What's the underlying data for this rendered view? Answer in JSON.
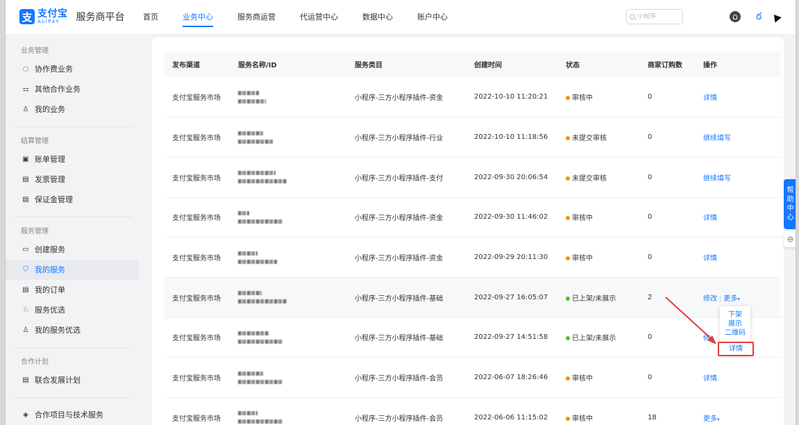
{
  "header": {
    "logo_mark": "支",
    "logo_cn": "支付宝",
    "logo_en": "ALIPAY",
    "platform": "服务商平台",
    "nav": [
      {
        "label": "首页",
        "active": false
      },
      {
        "label": "业务中心",
        "active": true
      },
      {
        "label": "服务商运营",
        "active": false
      },
      {
        "label": "代运营中心",
        "active": false
      },
      {
        "label": "数据中心",
        "active": false
      },
      {
        "label": "账户中心",
        "active": false
      }
    ],
    "search_placeholder": "小程序"
  },
  "sidebar": {
    "groups": [
      {
        "title": "业务管理",
        "items": [
          {
            "icon": "◌",
            "label": "协作费业务"
          },
          {
            "icon": "⚏",
            "label": "其他合作业务"
          },
          {
            "icon": "♙",
            "label": "我的业务"
          }
        ]
      },
      {
        "title": "结算管理",
        "items": [
          {
            "icon": "▣",
            "label": "账单管理"
          },
          {
            "icon": "▤",
            "label": "发票管理"
          },
          {
            "icon": "▤",
            "label": "保证金管理"
          }
        ]
      },
      {
        "title": "服务管理",
        "items": [
          {
            "icon": "▭",
            "label": "创建服务"
          },
          {
            "icon": "⛉",
            "label": "我的服务",
            "active": true
          },
          {
            "icon": "▤",
            "label": "我的订单"
          },
          {
            "icon": "♘",
            "label": "服务优选"
          },
          {
            "icon": "♙",
            "label": "我的服务优选"
          }
        ]
      },
      {
        "title": "合作计划",
        "items": [
          {
            "icon": "▤",
            "label": "联合发展计划"
          }
        ]
      }
    ],
    "bottom_item": {
      "icon": "◈",
      "label": "合作项目与技术服务"
    }
  },
  "table": {
    "columns": [
      "发布渠道",
      "服务名称/ID",
      "服务类目",
      "创建时间",
      "状态",
      "商家订购数",
      "操作"
    ],
    "rows": [
      {
        "channel": "支付宝服务市场",
        "category": "小程序-三方小程序插件-资金",
        "created": "2022-10-10 11:20:21",
        "status": "审核中",
        "status_color": "#fa8c16",
        "orders": "0",
        "actions": [
          "详情"
        ]
      },
      {
        "channel": "支付宝服务市场",
        "category": "小程序-三方小程序插件-行业",
        "created": "2022-10-10 11:18:56",
        "status": "未提交审核",
        "status_color": "#fa8c16",
        "orders": "0",
        "actions": [
          "继续填写"
        ]
      },
      {
        "channel": "支付宝服务市场",
        "category": "小程序-三方小程序插件-支付",
        "created": "2022-09-30 20:06:54",
        "status": "未提交审核",
        "status_color": "#fa8c16",
        "orders": "0",
        "actions": [
          "继续填写"
        ]
      },
      {
        "channel": "支付宝服务市场",
        "category": "小程序-三方小程序插件-资金",
        "created": "2022-09-30 11:46:02",
        "status": "审核中",
        "status_color": "#fa8c16",
        "orders": "0",
        "actions": [
          "详情"
        ]
      },
      {
        "channel": "支付宝服务市场",
        "category": "小程序-三方小程序插件-资金",
        "created": "2022-09-29 20:11:30",
        "status": "审核中",
        "status_color": "#fa8c16",
        "orders": "0",
        "actions": [
          "详情"
        ]
      },
      {
        "channel": "支付宝服务市场",
        "category": "小程序-三方小程序插件-基础",
        "created": "2022-09-27 16:05:07",
        "status": "已上架/未展示",
        "status_color": "#52c41a",
        "orders": "2",
        "actions": [
          "修改",
          "更多"
        ],
        "highlight": true
      },
      {
        "channel": "支付宝服务市场",
        "category": "小程序-三方小程序插件-基础",
        "created": "2022-09-27 14:51:58",
        "status": "已上架/未展示",
        "status_color": "#52c41a",
        "orders": "0",
        "actions": [
          "修"
        ]
      },
      {
        "channel": "支付宝服务市场",
        "category": "小程序-三方小程序插件-会员",
        "created": "2022-06-07 18:26:46",
        "status": "审核中",
        "status_color": "#fa8c16",
        "orders": "0",
        "actions": [
          "详情"
        ]
      },
      {
        "channel": "支付宝服务市场",
        "category": "小程序-三方小程序插件-会员",
        "created": "2022-06-06 11:15:02",
        "status": "审核中",
        "status_color": "#fa8c16",
        "orders": "18",
        "actions": [
          "更多"
        ]
      }
    ]
  },
  "dropdown": {
    "items": [
      "下架",
      "展示",
      "二维码"
    ],
    "highlighted": "详情"
  },
  "help": {
    "chars": [
      "帮",
      "助",
      "中",
      "心"
    ],
    "secondary_icon": "⊖"
  }
}
